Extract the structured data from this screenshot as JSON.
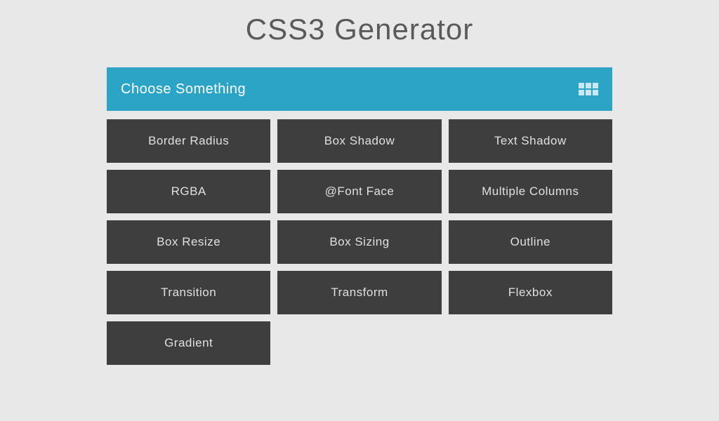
{
  "title": "CSS3 Generator",
  "header": {
    "label": "Choose Something"
  },
  "options": [
    "Border Radius",
    "Box Shadow",
    "Text Shadow",
    "RGBA",
    "@Font Face",
    "Multiple Columns",
    "Box Resize",
    "Box Sizing",
    "Outline",
    "Transition",
    "Transform",
    "Flexbox",
    "Gradient"
  ]
}
